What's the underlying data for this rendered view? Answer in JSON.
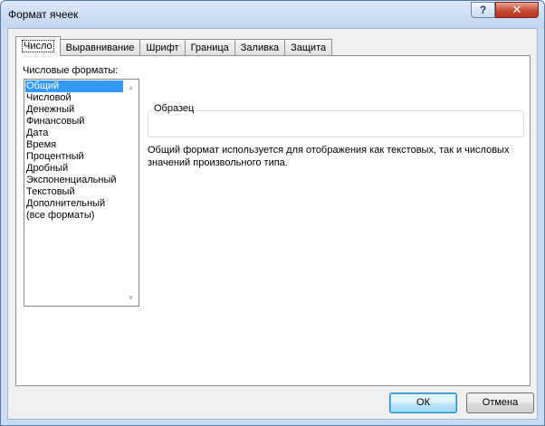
{
  "window": {
    "title": "Формат ячеек",
    "help_glyph": "?",
    "close_glyph": "✕"
  },
  "tabs": [
    {
      "label": "Число",
      "active": true
    },
    {
      "label": "Выравнивание",
      "active": false
    },
    {
      "label": "Шрифт",
      "active": false
    },
    {
      "label": "Граница",
      "active": false
    },
    {
      "label": "Заливка",
      "active": false
    },
    {
      "label": "Защита",
      "active": false
    }
  ],
  "number_tab": {
    "formats_label": "Числовые форматы:",
    "formats": [
      "Общий",
      "Числовой",
      "Денежный",
      "Финансовый",
      "Дата",
      "Время",
      "Процентный",
      "Дробный",
      "Экспоненциальный",
      "Текстовый",
      "Дополнительный",
      "(все форматы)"
    ],
    "selected_format": "Общий",
    "sample_label": "Образец",
    "description": "Общий формат используется для отображения как текстовых, так и числовых значений произвольного типа."
  },
  "buttons": {
    "ok": "ОК",
    "cancel": "Отмена"
  },
  "icons": {
    "scroll_up": "scroll-up-arrow-icon",
    "scroll_down": "scroll-down-arrow-icon"
  }
}
